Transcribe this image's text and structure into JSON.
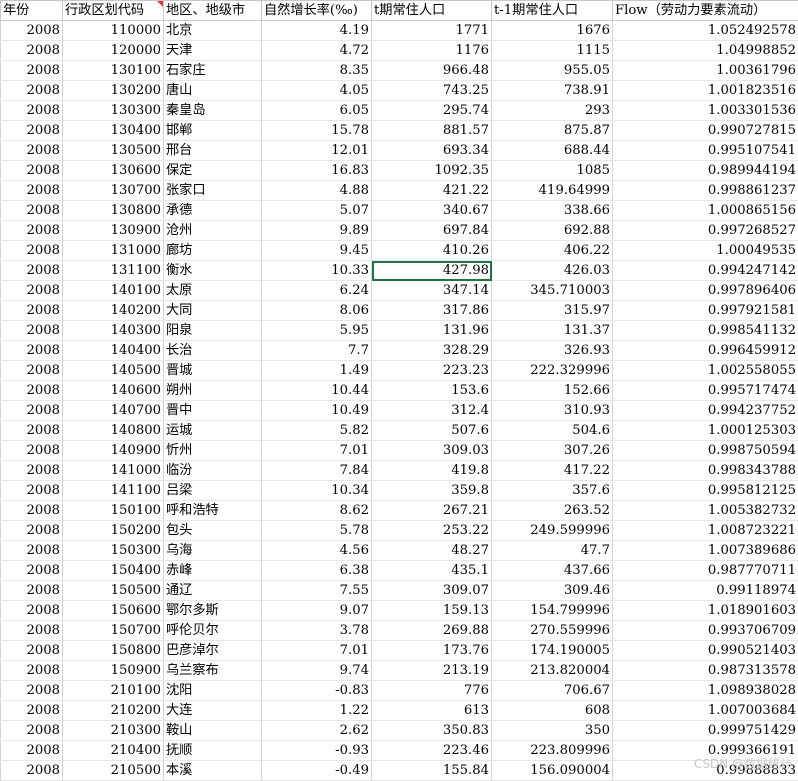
{
  "headers": [
    "年份",
    "行政区划代码",
    "地区、地级市",
    "自然增长率(‰)",
    "t期常住人口",
    "t-1期常住人口",
    "Flow（劳动力要素流动）"
  ],
  "rows": [
    [
      "2008",
      "110000",
      "北京",
      "4.19",
      "1771",
      "1676",
      "1.052492578"
    ],
    [
      "2008",
      "120000",
      "天津",
      "4.72",
      "1176",
      "1115",
      "1.04998852"
    ],
    [
      "2008",
      "130100",
      "石家庄",
      "8.35",
      "966.48",
      "955.05",
      "1.00361796"
    ],
    [
      "2008",
      "130200",
      "唐山",
      "4.05",
      "743.25",
      "738.91",
      "1.001823516"
    ],
    [
      "2008",
      "130300",
      "秦皇岛",
      "6.05",
      "295.74",
      "293",
      "1.003301536"
    ],
    [
      "2008",
      "130400",
      "邯郸",
      "15.78",
      "881.57",
      "875.87",
      "0.990727815"
    ],
    [
      "2008",
      "130500",
      "邢台",
      "12.01",
      "693.34",
      "688.44",
      "0.995107541"
    ],
    [
      "2008",
      "130600",
      "保定",
      "16.83",
      "1092.35",
      "1085",
      "0.989944194"
    ],
    [
      "2008",
      "130700",
      "张家口",
      "4.88",
      "421.22",
      "419.64999",
      "0.998861237"
    ],
    [
      "2008",
      "130800",
      "承德",
      "5.07",
      "340.67",
      "338.66",
      "1.000865156"
    ],
    [
      "2008",
      "130900",
      "沧州",
      "9.89",
      "697.84",
      "692.88",
      "0.997268527"
    ],
    [
      "2008",
      "131000",
      "廊坊",
      "9.45",
      "410.26",
      "406.22",
      "1.00049535"
    ],
    [
      "2008",
      "131100",
      "衡水",
      "10.33",
      "427.98",
      "426.03",
      "0.994247142"
    ],
    [
      "2008",
      "140100",
      "太原",
      "6.24",
      "347.14",
      "345.710003",
      "0.997896406"
    ],
    [
      "2008",
      "140200",
      "大同",
      "8.06",
      "317.86",
      "315.97",
      "0.997921581"
    ],
    [
      "2008",
      "140300",
      "阳泉",
      "5.95",
      "131.96",
      "131.37",
      "0.998541132"
    ],
    [
      "2008",
      "140400",
      "长治",
      "7.7",
      "328.29",
      "326.93",
      "0.996459912"
    ],
    [
      "2008",
      "140500",
      "晋城",
      "1.49",
      "223.23",
      "222.329996",
      "1.002558055"
    ],
    [
      "2008",
      "140600",
      "朔州",
      "10.44",
      "153.6",
      "152.66",
      "0.995717474"
    ],
    [
      "2008",
      "140700",
      "晋中",
      "10.49",
      "312.4",
      "310.93",
      "0.994237752"
    ],
    [
      "2008",
      "140800",
      "运城",
      "5.82",
      "507.6",
      "504.6",
      "1.000125303"
    ],
    [
      "2008",
      "140900",
      "忻州",
      "7.01",
      "309.03",
      "307.26",
      "0.998750594"
    ],
    [
      "2008",
      "141000",
      "临汾",
      "7.84",
      "419.8",
      "417.22",
      "0.998343788"
    ],
    [
      "2008",
      "141100",
      "吕梁",
      "10.34",
      "359.8",
      "357.6",
      "0.995812125"
    ],
    [
      "2008",
      "150100",
      "呼和浩特",
      "8.62",
      "267.21",
      "263.52",
      "1.005382732"
    ],
    [
      "2008",
      "150200",
      "包头",
      "5.78",
      "253.22",
      "249.599996",
      "1.008723221"
    ],
    [
      "2008",
      "150300",
      "乌海",
      "4.56",
      "48.27",
      "47.7",
      "1.007389686"
    ],
    [
      "2008",
      "150400",
      "赤峰",
      "6.38",
      "435.1",
      "437.66",
      "0.987770711"
    ],
    [
      "2008",
      "150500",
      "通辽",
      "7.55",
      "309.07",
      "309.46",
      "0.99118974"
    ],
    [
      "2008",
      "150600",
      "鄂尔多斯",
      "9.07",
      "159.13",
      "154.799996",
      "1.018901603"
    ],
    [
      "2008",
      "150700",
      "呼伦贝尔",
      "3.78",
      "269.88",
      "270.559996",
      "0.993706709"
    ],
    [
      "2008",
      "150800",
      "巴彦淖尔",
      "7.01",
      "173.76",
      "174.190005",
      "0.990521403"
    ],
    [
      "2008",
      "150900",
      "乌兰察布",
      "9.74",
      "213.19",
      "213.820004",
      "0.987313578"
    ],
    [
      "2008",
      "210100",
      "沈阳",
      "-0.83",
      "776",
      "706.67",
      "1.098938028"
    ],
    [
      "2008",
      "210200",
      "大连",
      "1.22",
      "613",
      "608",
      "1.007003684"
    ],
    [
      "2008",
      "210300",
      "鞍山",
      "2.62",
      "350.83",
      "350",
      "0.999751429"
    ],
    [
      "2008",
      "210400",
      "抚顺",
      "-0.93",
      "223.46",
      "223.809996",
      "0.999366191"
    ],
    [
      "2008",
      "210500",
      "本溪",
      "-0.49",
      "155.84",
      "156.090004",
      "0.99888833"
    ]
  ],
  "selected_cell": {
    "row": 12,
    "col": 4
  },
  "watermark": "CSDN @数据统计",
  "colors": {
    "selection": "#217346",
    "comment_marker": "#e03a3a",
    "grid": "#d4d4d4"
  }
}
